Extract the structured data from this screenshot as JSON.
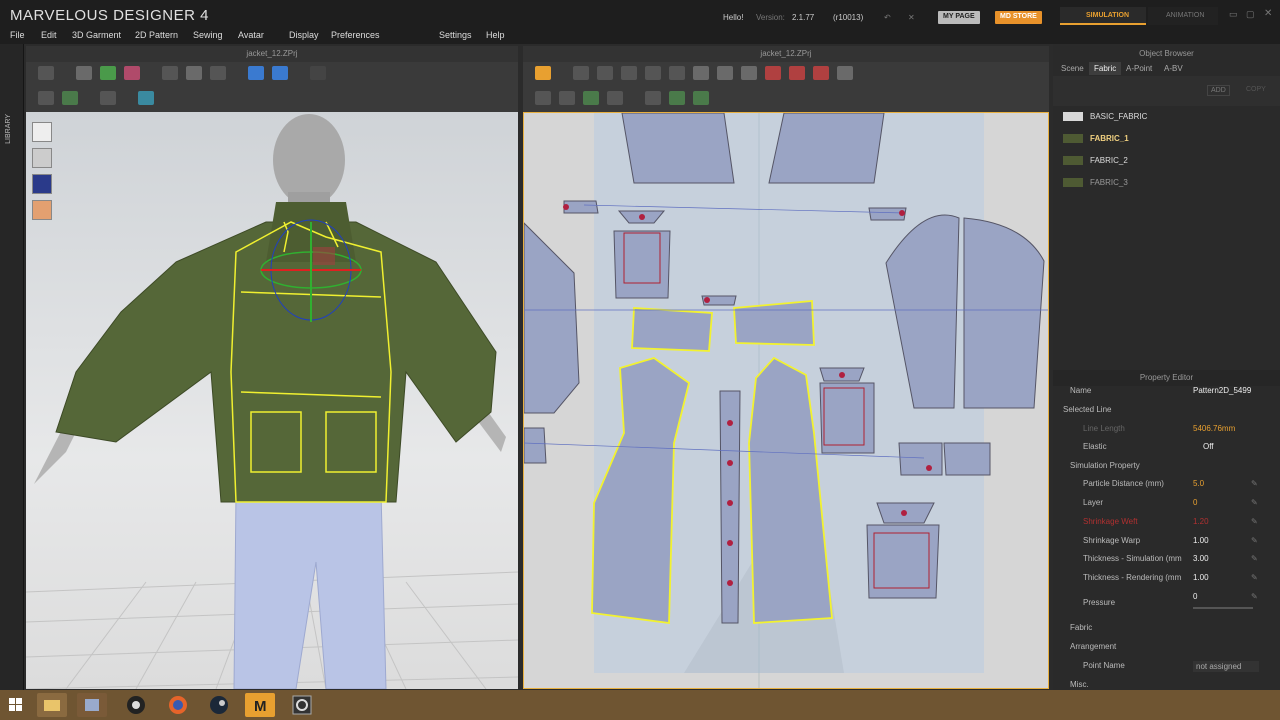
{
  "app": {
    "title": "MARVELOUS DESIGNER 4",
    "hello": "Hello!",
    "version_label": "Version:",
    "version": "2.1.77",
    "build": "(r10013)",
    "my_page": "MY PAGE",
    "md_store": "MD STORE",
    "simulation": "SIMULATION",
    "animation": "ANIMATION"
  },
  "menu": [
    "File",
    "Edit",
    "3D Garment",
    "2D Pattern",
    "Sewing",
    "Avatar",
    "Display",
    "Preferences",
    "Settings",
    "Help"
  ],
  "library_label": "LIBRARY",
  "pane3d": {
    "title": "jacket_12.ZPrj"
  },
  "pane2d": {
    "title": "jacket_12.ZPrj"
  },
  "object_browser": {
    "title": "Object Browser",
    "tabs": [
      "Scene",
      "Fabric",
      "A-Point",
      "A-BV"
    ],
    "add_label": "ADD",
    "copy_label": "COPY",
    "fabrics": [
      {
        "name": "BASIC_FABRIC",
        "color": "#d9d9d9"
      },
      {
        "name": "FABRIC_1",
        "color": "#4e5a33"
      },
      {
        "name": "FABRIC_2",
        "color": "#4e5a33"
      },
      {
        "name": "FABRIC_3",
        "color": "#4e5a33"
      }
    ]
  },
  "property_editor": {
    "title": "Property Editor",
    "rows": [
      {
        "label": "Name",
        "value": "Pattern2D_5499",
        "indent": 0
      },
      {
        "label": "Selected Line",
        "value": "",
        "indent": 1
      },
      {
        "label": "Line Length",
        "value": "5406.76mm",
        "indent": 2
      },
      {
        "label": "Elastic",
        "value": "Off",
        "indent": 2
      },
      {
        "label": "Simulation Property",
        "value": "",
        "indent": 1
      },
      {
        "label": "Particle Distance (mm)",
        "value": "5.0",
        "indent": 3
      },
      {
        "label": "Layer",
        "value": "0",
        "indent": 3
      },
      {
        "label": "Shrinkage Weft",
        "value": "1.20",
        "indent": 3
      },
      {
        "label": "Shrinkage Warp",
        "value": "1.00",
        "indent": 3
      },
      {
        "label": "Thickness - Simulation (mm",
        "value": "3.00",
        "indent": 3
      },
      {
        "label": "Thickness - Rendering (mm",
        "value": "1.00",
        "indent": 3
      },
      {
        "label": "Pressure",
        "value": "0",
        "indent": 2
      },
      {
        "label": "Fabric",
        "value": "",
        "indent": 1
      },
      {
        "label": "Arrangement",
        "value": "",
        "indent": 1
      },
      {
        "label": "Point Name",
        "value": "not assigned",
        "indent": 3
      },
      {
        "label": "Misc.",
        "value": "",
        "indent": 1
      }
    ]
  },
  "colors": {
    "accent": "#e8a030",
    "selection": "#f2f230",
    "fabric_green": "#4e5a33"
  },
  "taskbar_icons": [
    "start-icon",
    "file-explorer-icon",
    "vm-icon",
    "obs-icon",
    "firefox-icon",
    "steam-icon",
    "marvelous-designer-icon",
    "app-icon"
  ]
}
